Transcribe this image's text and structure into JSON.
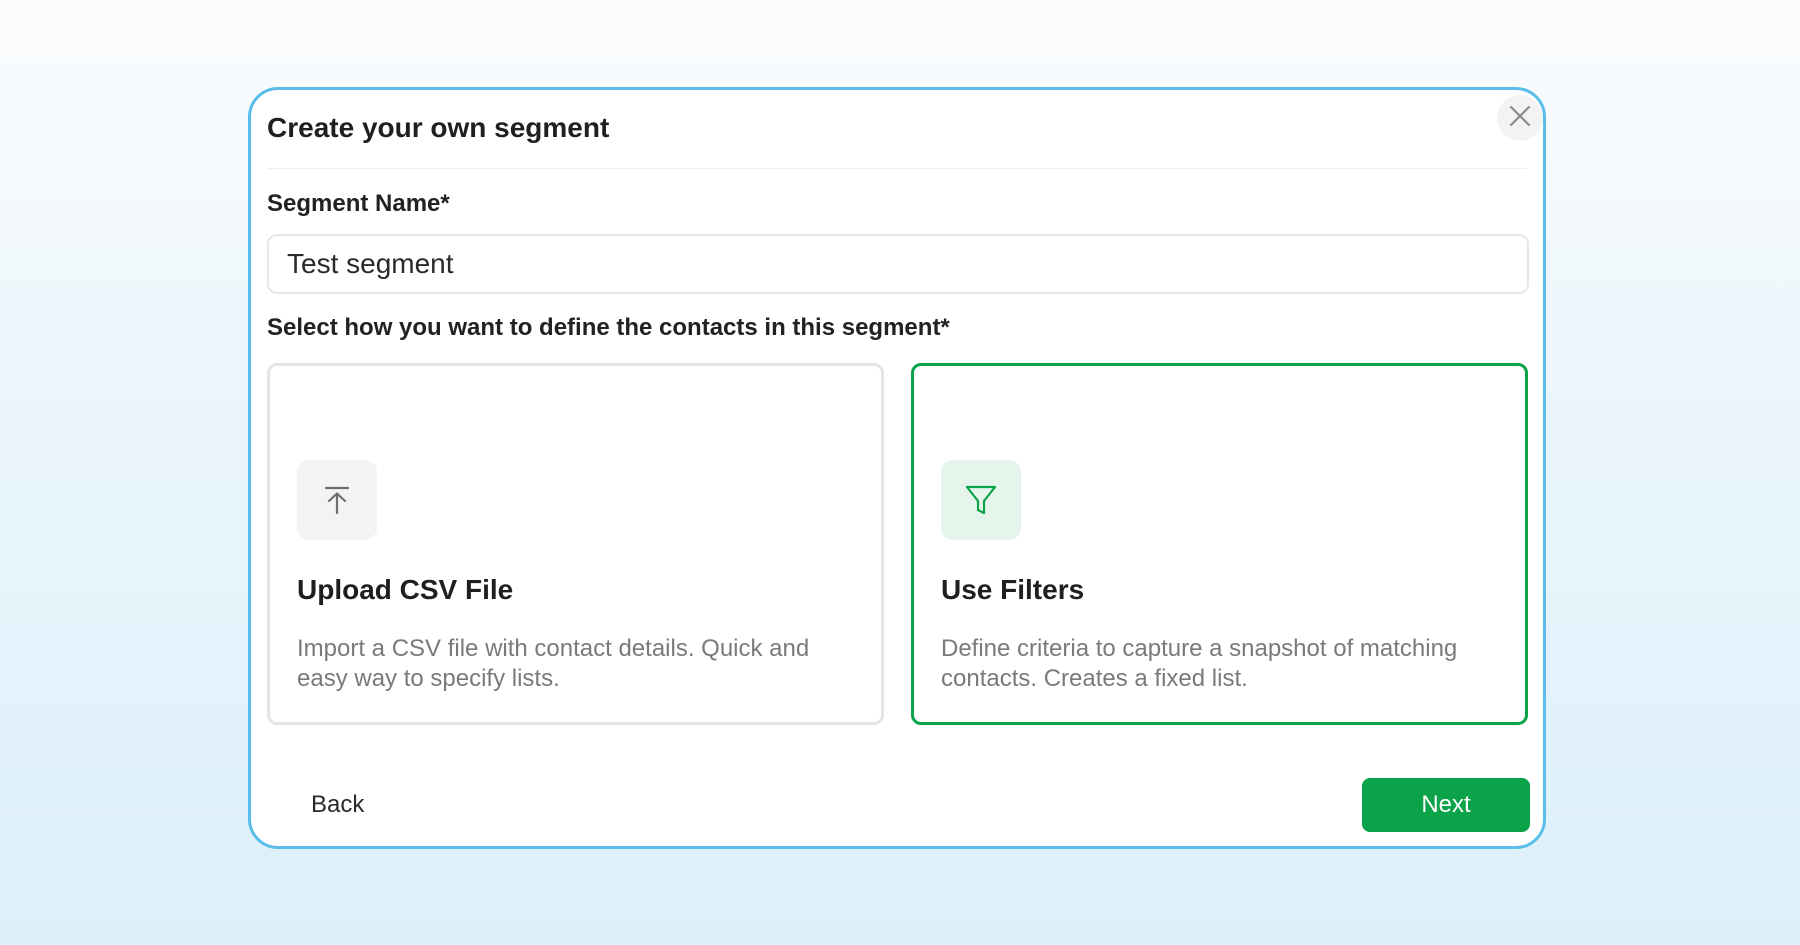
{
  "modal": {
    "title": "Create your own segment",
    "close_icon": "close-icon"
  },
  "segment_name": {
    "label": "Segment Name*",
    "value": "Test segment"
  },
  "definition": {
    "label": "Select how you want to define the contacts in this segment*",
    "options": [
      {
        "icon": "upload-icon",
        "title": "Upload CSV File",
        "description": "Import a CSV file with contact details. Quick and easy way to specify lists.",
        "selected": false
      },
      {
        "icon": "filter-icon",
        "title": "Use Filters",
        "description": "Define criteria to capture a snapshot of matching contacts. Creates a fixed list.",
        "selected": true
      }
    ]
  },
  "footer": {
    "back_label": "Back",
    "next_label": "Next"
  },
  "colors": {
    "accent": "#0aa34a",
    "modal_border": "#5bbde9"
  }
}
